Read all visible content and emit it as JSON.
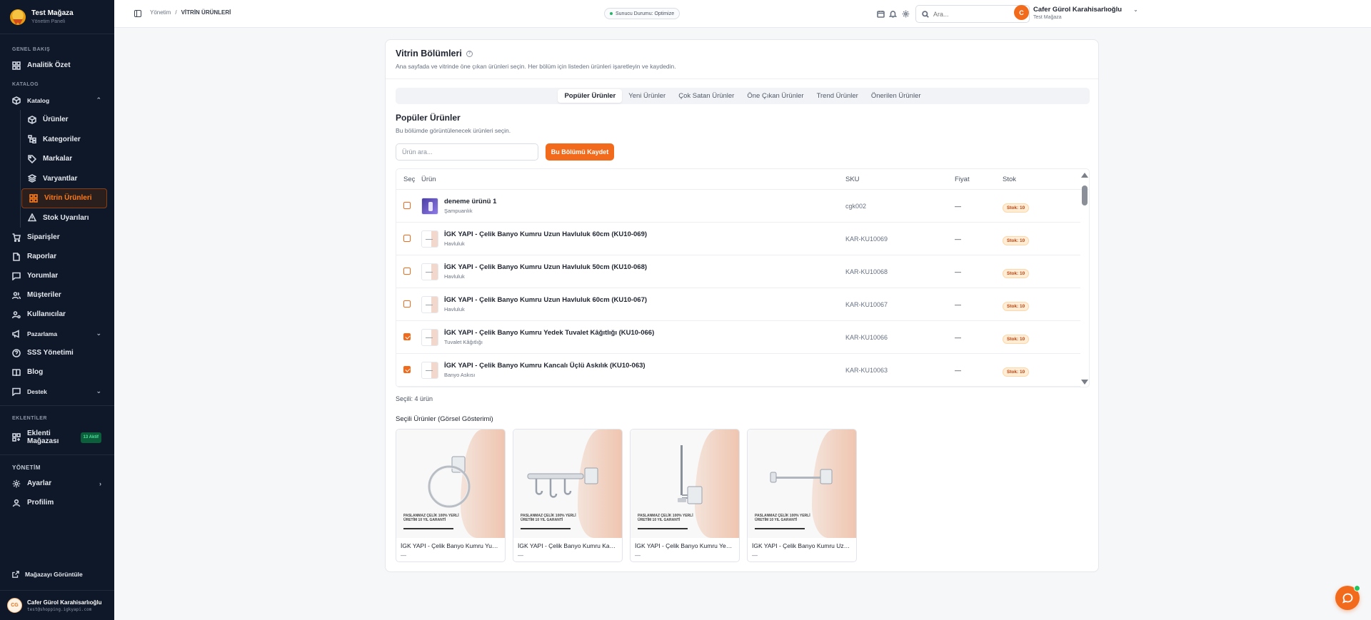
{
  "brand": {
    "title": "Test Mağaza",
    "subtitle": "Yönetim Paneli"
  },
  "sidebar": {
    "sections": {
      "overview": "GENEL BAKIŞ",
      "catalog": "KATALOG",
      "plugins": "EKLENTİLER",
      "admin": "YÖNETİM"
    },
    "analytics": "Analitik Özet",
    "catalog_label": "Katalog",
    "catalog_items": [
      "Ürünler",
      "Kategoriler",
      "Markalar",
      "Varyantlar",
      "Vitrin Ürünleri",
      "Stok Uyarıları"
    ],
    "orders": "Siparişler",
    "reports": "Raporlar",
    "comments": "Yorumlar",
    "customers": "Müşteriler",
    "users": "Kullanıcılar",
    "marketing": "Pazarlama",
    "faq": "SSS Yönetimi",
    "blog": "Blog",
    "support": "Destek",
    "plugin_store": "Eklenti Mağazası",
    "plugin_badge": "13 Aktif",
    "settings": "Ayarlar",
    "profile": "Profilim",
    "view_store": "Mağazayı Görüntüle",
    "user_initials": "CG",
    "user_name": "Cafer Gürol Karahisarlıoğlu",
    "user_email": "test@shopping.igkyapi.com"
  },
  "topbar": {
    "breadcrumb_root": "Yönetim",
    "breadcrumb_sep": "/",
    "breadcrumb_current": "VİTRİN ÜRÜNLERİ",
    "server_status": "Sunucu Durumu: Optimize",
    "search_placeholder": "Ara...",
    "user_initial": "C",
    "user_name": "Cafer Gürol Karahisarlıoğlu",
    "user_store": "Test Mağaza"
  },
  "card": {
    "title": "Vitrin Bölümleri",
    "description": "Ana sayfada ve vitrinde öne çıkan ürünleri seçin. Her bölüm için listeden ürünleri işaretleyin ve kaydedin.",
    "tabs": [
      "Popüler Ürünler",
      "Yeni Ürünler",
      "Çok Satan Ürünler",
      "Öne Çıkan Ürünler",
      "Trend Ürünler",
      "Önerilen Ürünler"
    ],
    "active_tab": "Popüler Ürünler",
    "section_title": "Popüler Ürünler",
    "section_desc": "Bu bölümde görüntülenecek ürünleri seçin.",
    "search_placeholder": "Ürün ara...",
    "save_label": "Bu Bölümü Kaydet",
    "columns": {
      "select": "Seç",
      "product": "Ürün",
      "sku": "SKU",
      "price": "Fiyat",
      "stock": "Stok"
    },
    "rows": [
      {
        "checked": false,
        "thumb": "purple",
        "name": "deneme ürünü 1",
        "category": "Şampuanlık",
        "sku": "cgk002",
        "price": "—",
        "stock": "Stok: 10"
      },
      {
        "checked": false,
        "thumb": "prod",
        "name": "İGK YAPI - Çelik Banyo Kumru Uzun Havluluk 60cm (KU10-069)",
        "category": "Havluluk",
        "sku": "KAR-KU10069",
        "price": "—",
        "stock": "Stok: 10"
      },
      {
        "checked": false,
        "thumb": "prod",
        "name": "İGK YAPI - Çelik Banyo Kumru Uzun Havluluk 50cm (KU10-068)",
        "category": "Havluluk",
        "sku": "KAR-KU10068",
        "price": "—",
        "stock": "Stok: 10"
      },
      {
        "checked": false,
        "thumb": "prod",
        "name": "İGK YAPI - Çelik Banyo Kumru Uzun Havluluk 60cm (KU10-067)",
        "category": "Havluluk",
        "sku": "KAR-KU10067",
        "price": "—",
        "stock": "Stok: 10"
      },
      {
        "checked": true,
        "thumb": "prod",
        "name": "İGK YAPI - Çelik Banyo Kumru Yedek Tuvalet Kâğıtlığı (KU10-066)",
        "category": "Tuvalet Kâğıtlığı",
        "sku": "KAR-KU10066",
        "price": "—",
        "stock": "Stok: 10"
      },
      {
        "checked": true,
        "thumb": "prod",
        "name": "İGK YAPI - Çelik Banyo Kumru Kancalı Üçlü Askılık (KU10-063)",
        "category": "Banyo Askısı",
        "sku": "KAR-KU10063",
        "price": "—",
        "stock": "Stok: 10"
      }
    ],
    "selected_count": "Seçili: 4 ürün",
    "selected_title": "Seçili Ürünler (Görsel Gösterimi)",
    "gallery": [
      {
        "caption": "İGK YAPI - Çelik Banyo Kumru Yuvarlak Havluluk",
        "price": "—",
        "kind": "ring",
        "img_text": "PASLANMAZ ÇELİK 100% YERLİ ÜRETİM 10 YIL GARANTİ"
      },
      {
        "caption": "İGK YAPI - Çelik Banyo Kumru Kancalı Üçlü Askılık",
        "price": "—",
        "kind": "hooks",
        "img_text": "PASLANMAZ ÇELİK 100% YERLİ ÜRETİM 10 YIL GARANTİ"
      },
      {
        "caption": "İGK YAPI - Çelik Banyo Kumru Yedek Tuvalet Kâğıtlığı",
        "price": "—",
        "kind": "spare",
        "img_text": "PASLANMAZ ÇELİK 100% YERLİ ÜRETİM 10 YIL GARANTİ"
      },
      {
        "caption": "İGK YAPI - Çelik Banyo Kumru Uzun Havluluk",
        "price": "—",
        "kind": "bar",
        "img_text": "PASLANMAZ ÇELİK 100% YERLİ ÜRETİM 10 YIL GARANTİ"
      }
    ]
  },
  "colors": {
    "accent": "#f26b1d",
    "sidebar_bg": "#0f1828",
    "success": "#22c55e"
  }
}
